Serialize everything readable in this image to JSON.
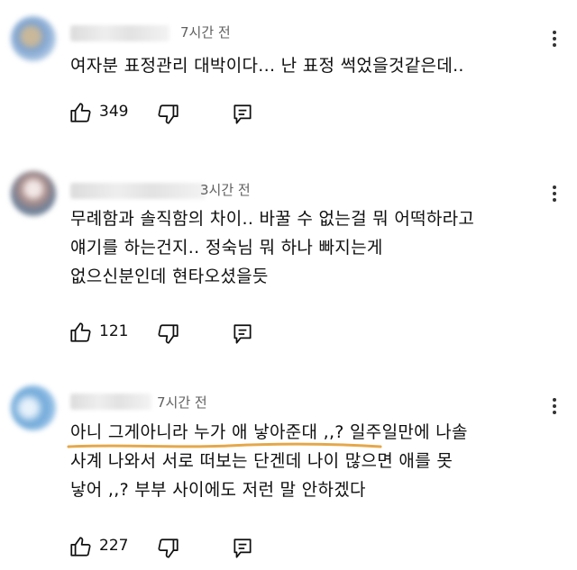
{
  "comments": [
    {
      "time": "7시간 전",
      "lines": [
        "여자분 표정관리 대박이다... 난 표정 썩었을것같은데.."
      ],
      "likes": "349",
      "avatar_color": "#7fa3cf"
    },
    {
      "time": "3시간 전",
      "lines": [
        "무례함과 솔직함의 차이.. 바꿀 수 없는걸 뭐 어떡하라고",
        "얘기를 하는건지.. 정숙님 뭐 하나 빠지는게",
        "없으신분인데 현타오셨을듯"
      ],
      "likes": "121",
      "avatar_color": "#a88c8a"
    },
    {
      "time": "7시간 전",
      "lines": [
        "아니 그게아니라 누가 애 낳아준대 ,,? 일주일만에 나솔",
        "사계 나와서 서로 떠보는 단겐데 나이 많으면 애를 못",
        "낳어 ,,? 부부 사이에도 저런 말 안하겠다"
      ],
      "likes": "227",
      "avatar_color": "#6fa8d8",
      "highlight_color": "#e5a84a"
    }
  ]
}
